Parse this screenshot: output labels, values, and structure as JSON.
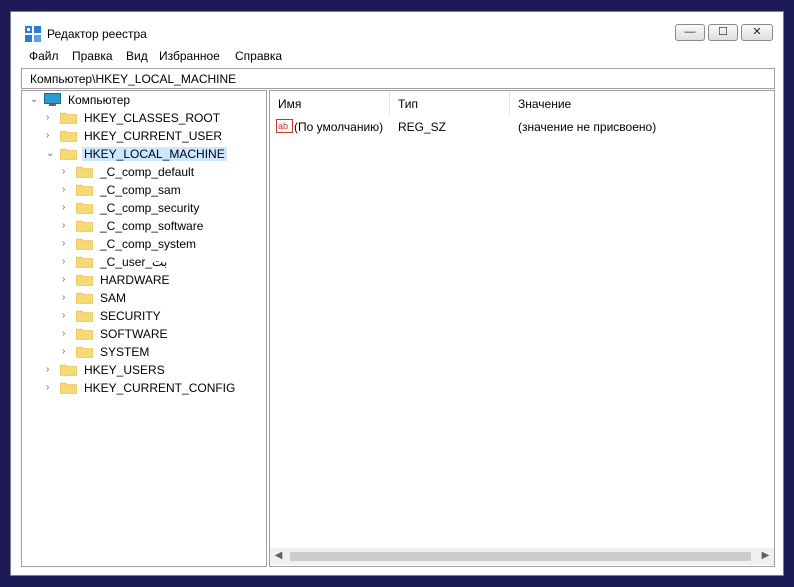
{
  "window": {
    "title": "Редактор реестра",
    "controls": {
      "minimize": "—",
      "maximize": "☐",
      "close": "✕"
    }
  },
  "menu": [
    "Файл",
    "Правка",
    "Вид",
    "Избранное",
    "Справка"
  ],
  "address": "Компьютер\\HKEY_LOCAL_MACHINE",
  "tree": {
    "root": "Компьютер",
    "hives": [
      {
        "label": "HKEY_CLASSES_ROOT",
        "expanded": false,
        "selected": false
      },
      {
        "label": "HKEY_CURRENT_USER",
        "expanded": false,
        "selected": false
      },
      {
        "label": "HKEY_LOCAL_MACHINE",
        "expanded": true,
        "selected": true,
        "children": [
          "_C_comp_default",
          "_C_comp_sam",
          "_C_comp_security",
          "_C_comp_software",
          "_C_comp_system",
          "_C_user_بت",
          "HARDWARE",
          "SAM",
          "SECURITY",
          "SOFTWARE",
          "SYSTEM"
        ]
      },
      {
        "label": "HKEY_USERS",
        "expanded": false,
        "selected": false
      },
      {
        "label": "HKEY_CURRENT_CONFIG",
        "expanded": false,
        "selected": false
      }
    ]
  },
  "list": {
    "columns": [
      "Имя",
      "Тип",
      "Значение"
    ],
    "rows": [
      {
        "icon": "string-value-icon",
        "name": "(По умолчанию)",
        "type": "REG_SZ",
        "value": "(значение не присвоено)"
      }
    ]
  },
  "colors": {
    "background": "#1c1a55",
    "selection": "#cce8ff",
    "folder": "#f8d775",
    "accent": "#2b7cd3"
  }
}
